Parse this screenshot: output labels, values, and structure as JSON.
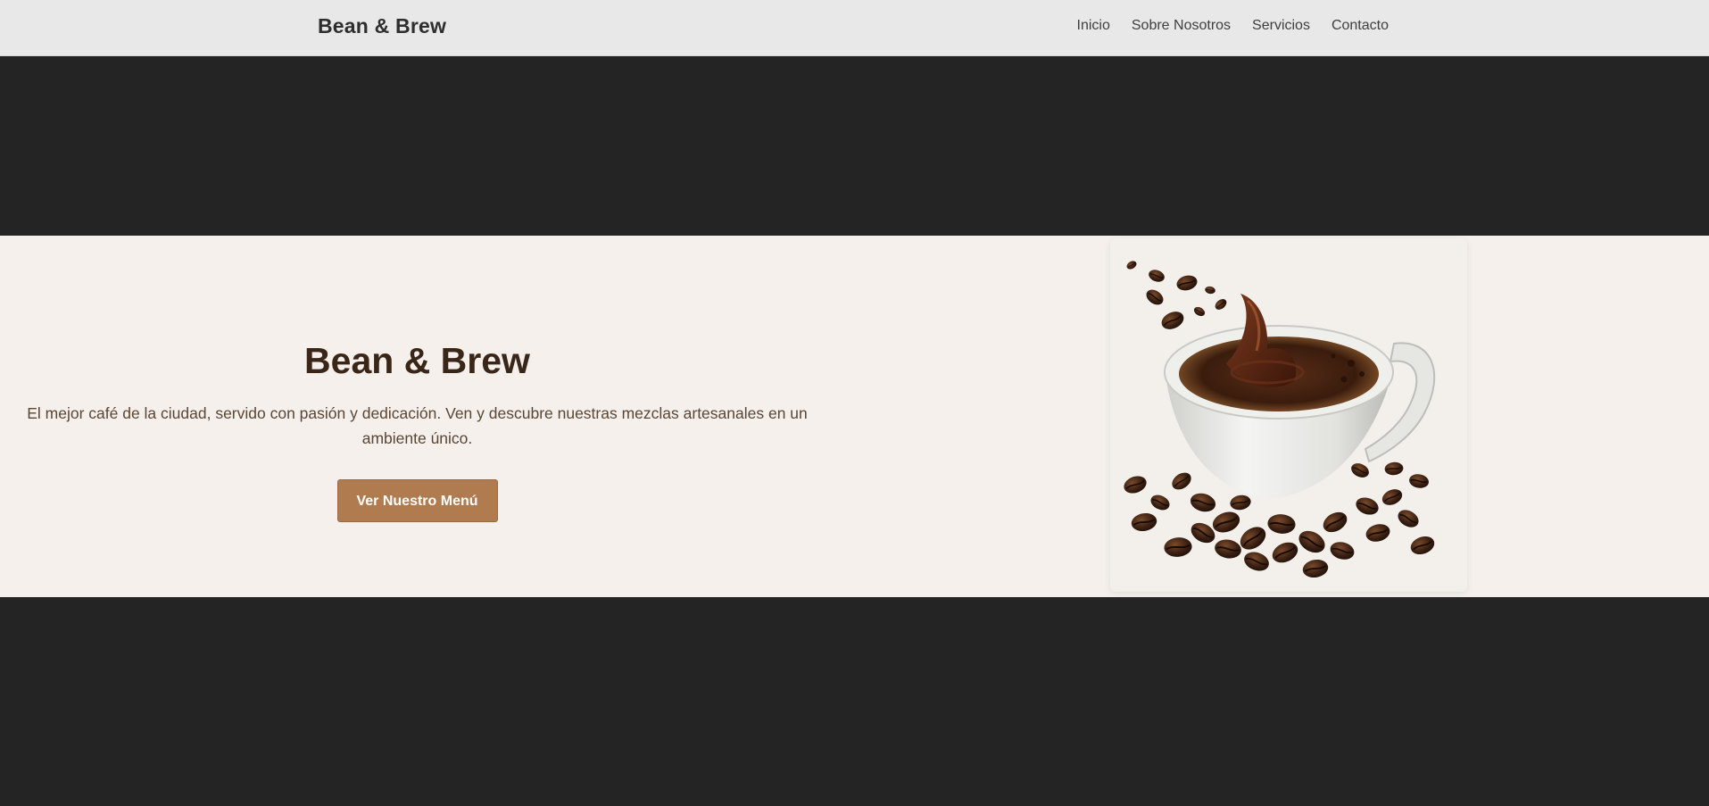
{
  "navbar": {
    "brand": "Bean & Brew",
    "links": [
      "Inicio",
      "Sobre Nosotros",
      "Servicios",
      "Contacto"
    ]
  },
  "hero": {
    "title": "Bean & Brew",
    "description": "El mejor café de la ciudad, servido con pasión y dedicación. Ven y descubre nuestras mezclas artesanales en un ambiente único.",
    "button_label": "Ver Nuestro Menú",
    "image_icon": "coffee-cup-with-beans-image"
  },
  "colors": {
    "navbar_bg": "#e8e8e8",
    "dark_bg": "#242424",
    "hero_bg": "#f5f0eb",
    "title_color": "#3a2618",
    "button_bg": "#b07b4f"
  }
}
